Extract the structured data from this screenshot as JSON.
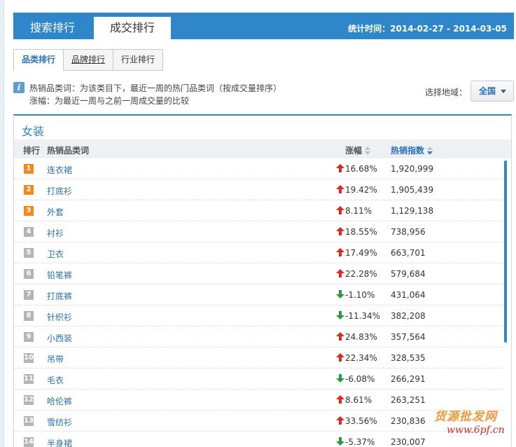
{
  "header": {
    "tabs": [
      {
        "label": "搜索排行"
      },
      {
        "label": "成交排行"
      }
    ],
    "stat_time": "统计时间：2014-02-27 - 2014-03-05"
  },
  "subtabs": [
    {
      "label": "品类排行"
    },
    {
      "label": "品牌排行"
    },
    {
      "label": "行业排行"
    }
  ],
  "info": {
    "icon": "info-icon",
    "line1": "热销品类词：为该类目下，最近一周的热门品类词（按成交量排序）",
    "line2": "涨幅：为最近一周与之前一周成交量的比较"
  },
  "region": {
    "label": "选择地域：",
    "value": "全国"
  },
  "panel": {
    "title": "女装",
    "columns": {
      "rank": "排行",
      "name": "热销品类词",
      "change": "涨幅",
      "index": "热销指数"
    },
    "rows": [
      {
        "rank": "1",
        "name": "连衣裙",
        "change": "16.68%",
        "trend": "up",
        "index": "1,920,999"
      },
      {
        "rank": "2",
        "name": "打底衫",
        "change": "19.42%",
        "trend": "up",
        "index": "1,905,439"
      },
      {
        "rank": "3",
        "name": "外套",
        "change": "8.11%",
        "trend": "up",
        "index": "1,129,138"
      },
      {
        "rank": "4",
        "name": "衬衫",
        "change": "18.55%",
        "trend": "up",
        "index": "738,956"
      },
      {
        "rank": "5",
        "name": "卫衣",
        "change": "17.49%",
        "trend": "up",
        "index": "663,701"
      },
      {
        "rank": "6",
        "name": "铅笔裤",
        "change": "22.28%",
        "trend": "up",
        "index": "579,684"
      },
      {
        "rank": "7",
        "name": "打底裤",
        "change": "-1.10%",
        "trend": "down",
        "index": "431,064"
      },
      {
        "rank": "8",
        "name": "针织衫",
        "change": "-11.34%",
        "trend": "down",
        "index": "382,208"
      },
      {
        "rank": "9",
        "name": "小西装",
        "change": "24.83%",
        "trend": "up",
        "index": "357,564"
      },
      {
        "rank": "10",
        "name": "吊带",
        "change": "22.34%",
        "trend": "up",
        "index": "328,535"
      },
      {
        "rank": "11",
        "name": "毛衣",
        "change": "-6.08%",
        "trend": "down",
        "index": "266,291"
      },
      {
        "rank": "12",
        "name": "哈伦裤",
        "change": "8.61%",
        "trend": "up",
        "index": "263,251"
      },
      {
        "rank": "13",
        "name": "雪纺衫",
        "change": "33.56%",
        "trend": "up",
        "index": "230,836"
      },
      {
        "rank": "14",
        "name": "半身裙",
        "change": "-5.37%",
        "trend": "down",
        "index": "230,007"
      }
    ]
  },
  "watermark": {
    "line1": "货源批发网",
    "line2": "www.6pf.cn"
  },
  "colors": {
    "accent": "#2f86c9",
    "link": "#2b6fb5",
    "up": "#e0281e",
    "down": "#2a9a3a",
    "top_rank": "#f08a1c",
    "rank": "#b5b5b5"
  }
}
